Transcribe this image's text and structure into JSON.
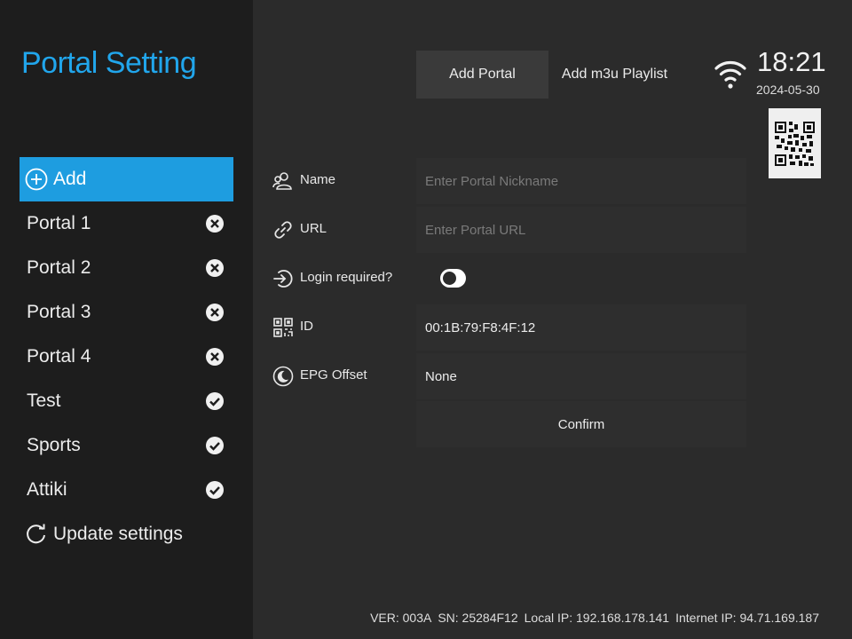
{
  "sidebar": {
    "title": "Portal Setting",
    "add_label": "Add",
    "portals": [
      {
        "label": "Portal 1",
        "status": "remove"
      },
      {
        "label": "Portal 2",
        "status": "remove"
      },
      {
        "label": "Portal 3",
        "status": "remove"
      },
      {
        "label": "Portal 4",
        "status": "remove"
      },
      {
        "label": "Test",
        "status": "ok"
      },
      {
        "label": "Sports",
        "status": "ok"
      },
      {
        "label": "Attiki",
        "status": "ok"
      }
    ],
    "update_label": "Update settings"
  },
  "tabs": [
    "Add Portal",
    "Add m3u Playlist"
  ],
  "status": {
    "time": "18:21",
    "date": "2024-05-30",
    "wifi_icon": "wifi-icon",
    "qr_icon": "qr-code-icon"
  },
  "form": {
    "name": {
      "label": "Name",
      "placeholder": "Enter Portal Nickname",
      "value": ""
    },
    "url": {
      "label": "URL",
      "placeholder": "Enter Portal URL",
      "value": ""
    },
    "login": {
      "label": "Login required?",
      "enabled": false
    },
    "id": {
      "label": "ID",
      "value": "00:1B:79:F8:4F:12"
    },
    "epg": {
      "label": "EPG Offset",
      "value": "None"
    },
    "confirm_label": "Confirm"
  },
  "footer": {
    "ver": "VER: 003A",
    "sn": "SN: 25284F12",
    "local_ip": "Local IP: 192.168.178.141",
    "internet_ip": "Internet IP: 94.71.169.187"
  },
  "colors": {
    "accent": "#21a6ec",
    "selected_bg": "#1e9de0",
    "sidebar_bg": "#1d1d1d",
    "main_bg": "#2b2b2b"
  }
}
